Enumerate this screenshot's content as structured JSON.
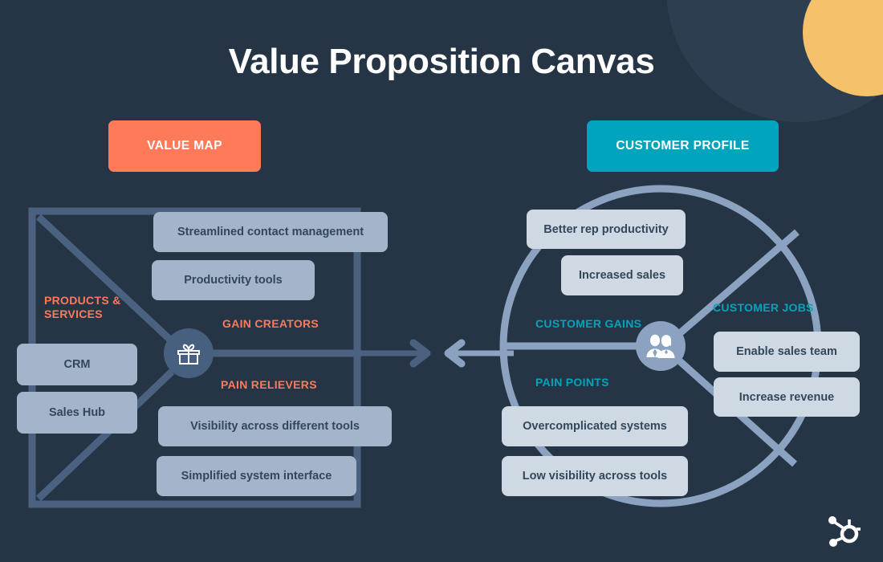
{
  "page": {
    "title": "Value Proposition Canvas",
    "background_color": "#253545",
    "brand_logo": "hubspot-sprocket-logo"
  },
  "colors": {
    "accent_orange": "#ff7a59",
    "accent_teal": "#00a4bd",
    "deco_teal": "#13b5a1",
    "deco_yellow": "#f5c26b",
    "card_left": "#a4b4cb",
    "card_right": "#cfd9e3",
    "line_left": "#4a6180",
    "line_right": "#8ba3c0",
    "text_dark": "#33475b"
  },
  "value_map": {
    "badge_label": "VALUE MAP",
    "hub_icon": "gift-icon",
    "sections": [
      {
        "label": "PRODUCTS &\nSERVICES",
        "label_line1": "PRODUCTS &",
        "label_line2": "SERVICES"
      },
      {
        "label": "GAIN CREATORS"
      },
      {
        "label": "PAIN RELIEVERS"
      }
    ],
    "products_services_label_line1": "PRODUCTS &",
    "products_services_label_line2": "SERVICES",
    "gain_creators_label": "GAIN CREATORS",
    "pain_relievers_label": "PAIN RELIEVERS",
    "products_services_cards": [
      "CRM",
      "Sales Hub"
    ],
    "gain_creators_cards": [
      "Streamlined contact management",
      "Productivity tools"
    ],
    "pain_relievers_cards": [
      "Visibility across different tools",
      "Simplified system interface"
    ]
  },
  "customer_profile": {
    "badge_label": "CUSTOMER PROFILE",
    "hub_icon": "customers-people-icon",
    "customer_gains_label": "CUSTOMER GAINS",
    "customer_jobs_label": "CUSTOMER JOBS",
    "pain_points_label": "PAIN POINTS",
    "customer_gains_cards": [
      "Better rep productivity",
      "Increased sales"
    ],
    "customer_jobs_cards": [
      "Enable sales team",
      "Increase revenue"
    ],
    "pain_points_cards": [
      "Overcomplicated systems",
      "Low visibility across tools"
    ]
  },
  "connector": {
    "left_arrow_icon": "arrow-right-icon",
    "right_arrow_icon": "arrow-left-icon"
  }
}
